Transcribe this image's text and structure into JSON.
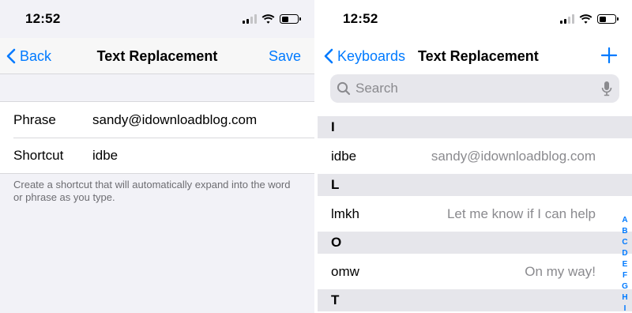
{
  "left": {
    "status": {
      "time": "12:52"
    },
    "nav": {
      "back_label": "Back",
      "title": "Text Replacement",
      "save_label": "Save"
    },
    "form": {
      "phrase_label": "Phrase",
      "phrase_value": "sandy@idownloadblog.com",
      "shortcut_label": "Shortcut",
      "shortcut_value": "idbe"
    },
    "footnote": "Create a shortcut that will automatically expand into the word or phrase as you type."
  },
  "right": {
    "status": {
      "time": "12:52"
    },
    "nav": {
      "back_label": "Keyboards",
      "title": "Text Replacement",
      "add_icon": "plus-icon"
    },
    "search": {
      "placeholder": "Search",
      "icons": [
        "magnifier-icon",
        "microphone-icon"
      ]
    },
    "sections": [
      {
        "letter": "I",
        "items": [
          {
            "shortcut": "idbe",
            "phrase": "sandy@idownloadblog.com"
          }
        ]
      },
      {
        "letter": "L",
        "items": [
          {
            "shortcut": "lmkh",
            "phrase": "Let me know if I can help"
          }
        ]
      },
      {
        "letter": "O",
        "items": [
          {
            "shortcut": "omw",
            "phrase": "On my way!"
          }
        ]
      },
      {
        "letter": "T",
        "items": []
      }
    ],
    "index_letters": [
      "A",
      "B",
      "C",
      "D",
      "E",
      "F",
      "G",
      "H",
      "I"
    ]
  },
  "colors": {
    "accent": "#007aff",
    "secondary_text": "#8a8a8e",
    "grouped_background": "#f2f2f7",
    "section_header": "#e6e6eb"
  },
  "status_icons": [
    "cellular-signal-icon",
    "wifi-icon",
    "battery-icon"
  ]
}
